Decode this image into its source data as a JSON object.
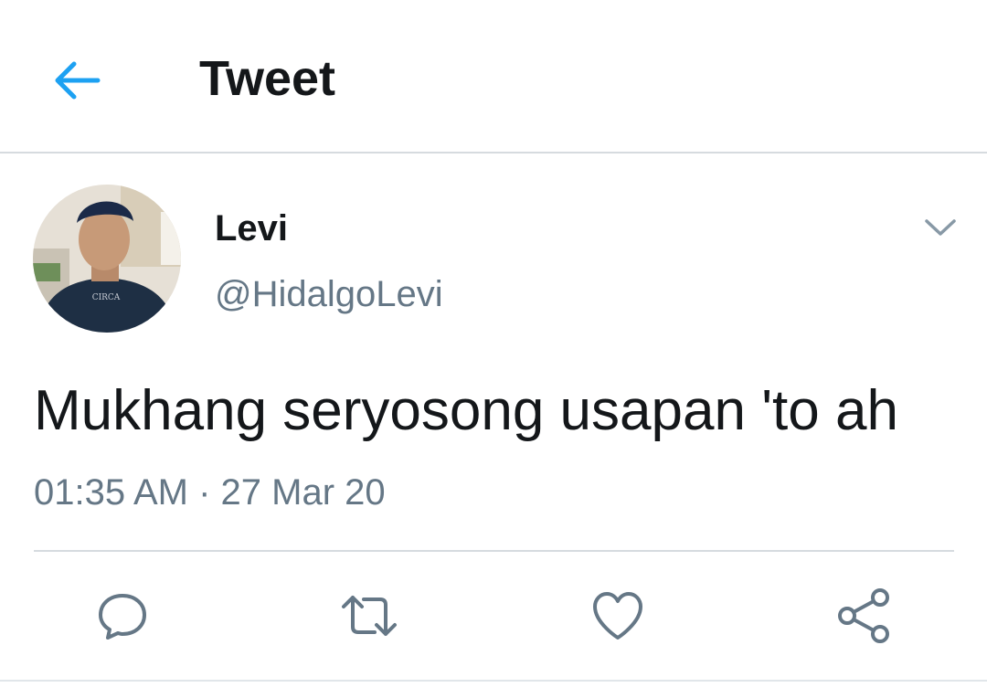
{
  "header": {
    "title": "Tweet",
    "back_icon": "arrow-left-icon",
    "accent_color": "#1da1f2"
  },
  "tweet": {
    "author": {
      "display_name": "Levi",
      "handle": "@HidalgoLevi",
      "shirt_text": "CIRCA"
    },
    "text": "Mukhang seryosong usapan 'to ah",
    "timestamp": "01:35 AM · 27 Mar 20",
    "more_icon": "chevron-down-icon"
  },
  "actions": [
    {
      "name": "reply",
      "icon": "comment-icon"
    },
    {
      "name": "retweet",
      "icon": "retweet-icon"
    },
    {
      "name": "like",
      "icon": "heart-icon"
    },
    {
      "name": "share",
      "icon": "share-icon"
    }
  ],
  "colors": {
    "text_primary": "#14171a",
    "text_secondary": "#657786",
    "divider": "#d6dbdf"
  }
}
